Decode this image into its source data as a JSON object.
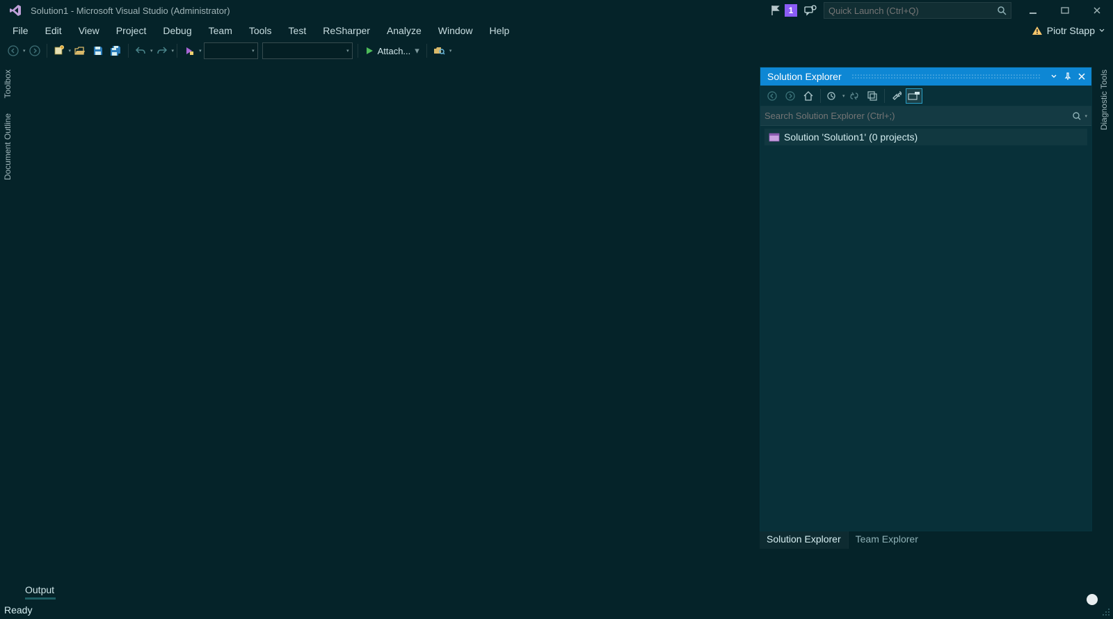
{
  "titlebar": {
    "title": "Solution1 - Microsoft Visual Studio (Administrator)",
    "notif_count": "1",
    "quick_launch_placeholder": "Quick Launch (Ctrl+Q)"
  },
  "menubar": {
    "items": [
      "File",
      "Edit",
      "View",
      "Project",
      "Debug",
      "Team",
      "Tools",
      "Test",
      "ReSharper",
      "Analyze",
      "Window",
      "Help"
    ],
    "account_name": "Piotr Stapp"
  },
  "toolbar": {
    "attach_label": "Attach..."
  },
  "left_rail": {
    "toolbox": "Toolbox",
    "doc_outline": "Document Outline"
  },
  "right_rail": {
    "diag_tools": "Diagnostic Tools"
  },
  "solexp": {
    "title": "Solution Explorer",
    "search_placeholder": "Search Solution Explorer (Ctrl+;)",
    "root_node": "Solution 'Solution1' (0 projects)",
    "tabs": [
      "Solution Explorer",
      "Team Explorer"
    ]
  },
  "bottom": {
    "output_tab": "Output",
    "status": "Ready"
  }
}
